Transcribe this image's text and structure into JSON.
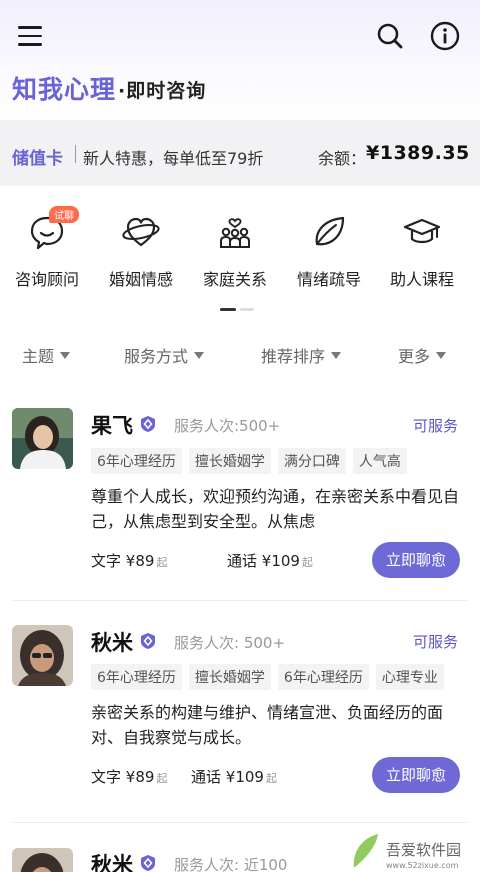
{
  "header": {
    "brand": "知我心理",
    "subtitle": "·即时咨询",
    "icons": [
      "menu-icon",
      "search-icon",
      "info-icon"
    ]
  },
  "stored_card": {
    "title": "储值卡",
    "promo": "新人特惠，每单低至79折",
    "balance_label": "余额：",
    "balance": "¥1389.35"
  },
  "categories": [
    {
      "label": "咨询顾问",
      "icon": "chat-bubble-icon",
      "badge": "试聊"
    },
    {
      "label": "婚姻情感",
      "icon": "heart-ring-icon"
    },
    {
      "label": "家庭关系",
      "icon": "family-icon"
    },
    {
      "label": "情绪疏导",
      "icon": "leaf-icon"
    },
    {
      "label": "助人课程",
      "icon": "graduation-cap-icon"
    }
  ],
  "filters": [
    "主题",
    "服务方式",
    "推荐排序",
    "更多"
  ],
  "counselors": [
    {
      "name": "果飞",
      "served": "服务人次:500+",
      "status": "可服务",
      "tags": [
        "6年心理经历",
        "擅长婚姻学",
        "满分口碑",
        "人气高"
      ],
      "description": "尊重个人成长，欢迎预约沟通，在亲密关系中看见自己，从焦虑型到安全型。从焦虑",
      "text_label": "文字",
      "text_price": "¥89",
      "call_label": "通话",
      "call_price": "¥109",
      "unit": "起",
      "button": "立即聊愈"
    },
    {
      "name": "秋米",
      "served": "服务人次: 500+",
      "status": "可服务",
      "tags": [
        "6年心理经历",
        "擅长婚姻学",
        "6年心理经历",
        "心理专业"
      ],
      "description": "亲密关系的构建与维护、情绪宣泄、负面经历的面对、自我察觉与成长。",
      "text_label": "文字",
      "text_price": "¥89",
      "call_label": "通话",
      "call_price": "¥109",
      "unit": "起",
      "button": "立即聊愈"
    },
    {
      "name": "秋米",
      "served": "服务人次: 近100"
    }
  ],
  "watermark": {
    "line1": "吾爱软件园",
    "line2": "www.52zixue.com"
  },
  "colors": {
    "accent": "#6a63d6",
    "button": "#6f69d6",
    "badge": "#ff6b4a"
  }
}
